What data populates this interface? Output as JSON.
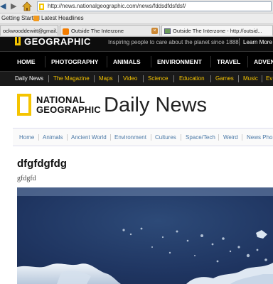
{
  "browser": {
    "url": "http://news.nationalgeographic.com/news/fddsdfdsfdsf/",
    "bookmarks": [
      "Getting Started",
      "Latest Headlines"
    ],
    "tabs": [
      {
        "label": "ockwooddewitt@gmail..."
      },
      {
        "label": "Outside The Interzone"
      },
      {
        "label": "Outside The Interzone - http://outsid..."
      }
    ]
  },
  "site": {
    "logo_text": "GEOGRAPHIC",
    "tagline": "Inspiring people to care about the planet since 1888",
    "learn_more": "Learn More",
    "main_nav": [
      "HOME",
      "PHOTOGRAPHY",
      "ANIMALS",
      "ENVIRONMENT",
      "TRAVEL",
      "ADVEN"
    ],
    "sub_nav": [
      "Daily News",
      "The Magazine",
      "Maps",
      "Video",
      "Science",
      "Education",
      "Games",
      "Music",
      "Ev"
    ]
  },
  "masthead": {
    "line1": "NATIONAL",
    "line2": "GEOGRAPHIC",
    "title": "Daily News"
  },
  "topic_nav": [
    "Home",
    "Animals",
    "Ancient World",
    "Environment",
    "Cultures",
    "Space/Tech",
    "Weird",
    "News Pho"
  ],
  "article": {
    "headline": "dfgfdgfdg",
    "subhead": "gfdgfd"
  },
  "colors": {
    "brand_yellow": "#f5c400",
    "header_black": "#000000",
    "link_blue": "#4a78a6"
  }
}
